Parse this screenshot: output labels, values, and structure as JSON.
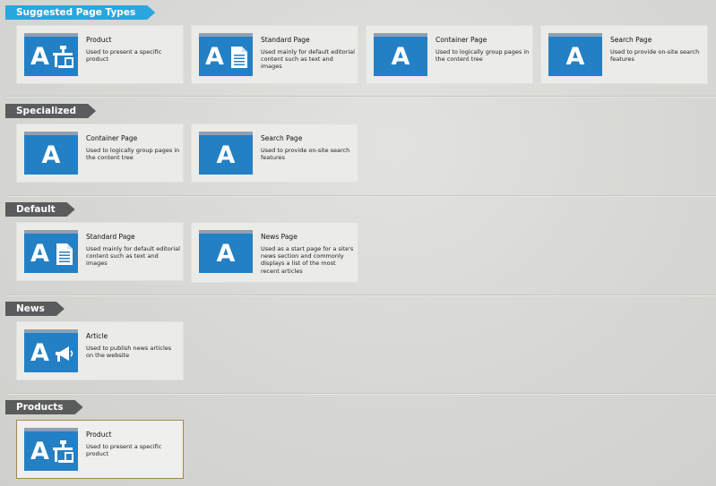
{
  "colors": {
    "accent_tag": "#2aa6df",
    "group_tag": "#5a5b5d",
    "thumbnail": "#2480c4",
    "selected_border": "#a38a4b"
  },
  "sections": [
    {
      "label": "Suggested Page Types",
      "cards": [
        {
          "title": "Product",
          "description": "Used to present a specific product",
          "icon": "product-icon"
        },
        {
          "title": "Standard Page",
          "description": "Used mainly for default editorial content such as text and images",
          "icon": "document-icon"
        },
        {
          "title": "Container Page",
          "description": "Used to logically group pages in the content tree",
          "icon": "letter-a-icon"
        },
        {
          "title": "Search Page",
          "description": "Used to provide on-site search features",
          "icon": "letter-a-icon"
        }
      ]
    },
    {
      "label": "Specialized",
      "cards": [
        {
          "title": "Container Page",
          "description": "Used to logically group pages in the content tree",
          "icon": "letter-a-icon"
        },
        {
          "title": "Search Page",
          "description": "Used to provide on-site search features",
          "icon": "letter-a-icon"
        }
      ]
    },
    {
      "label": "Default",
      "cards": [
        {
          "title": "Standard Page",
          "description": "Used mainly for default editorial content such as text and images",
          "icon": "document-icon"
        },
        {
          "title": "News Page",
          "description": "Used as a start page for a site's news section and commonly displays a list of the most recent articles",
          "icon": "letter-a-icon"
        }
      ]
    },
    {
      "label": "News",
      "cards": [
        {
          "title": "Article",
          "description": "Used to publish news articles on the website",
          "icon": "megaphone-icon"
        }
      ]
    },
    {
      "label": "Products",
      "cards": [
        {
          "title": "Product",
          "description": "Used to present a specific product",
          "icon": "product-icon",
          "selected": true
        }
      ]
    }
  ]
}
